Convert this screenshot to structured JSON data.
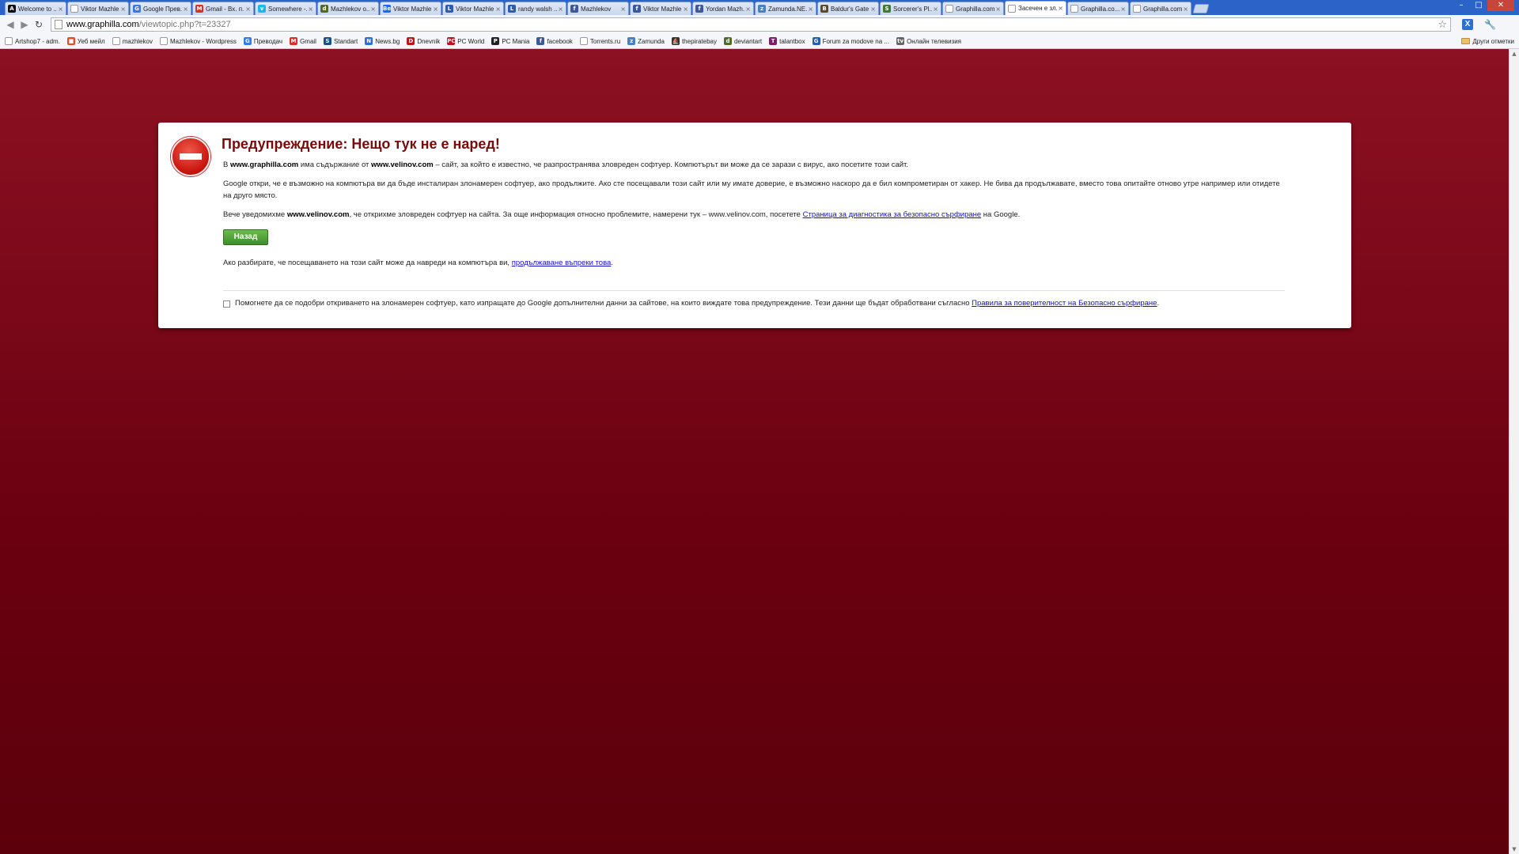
{
  "tabs": [
    {
      "label": "Welcome to ...",
      "icon": "A",
      "icon_bg": "#111111",
      "active": false
    },
    {
      "label": "Viktor Mazhle...",
      "icon": "",
      "icon_bg": "#ffffff",
      "active": false
    },
    {
      "label": "Google Прев...",
      "icon": "G",
      "icon_bg": "#3b78e7",
      "active": false
    },
    {
      "label": "Gmail - Вх. п...",
      "icon": "M",
      "icon_bg": "#d93025",
      "active": false
    },
    {
      "label": "Somewhere -...",
      "icon": "v",
      "icon_bg": "#1ab7ea",
      "active": false
    },
    {
      "label": "Mazhlekov o...",
      "icon": "d",
      "icon_bg": "#4f6b2a",
      "active": false
    },
    {
      "label": "Viktor Mazhle...",
      "icon": "Be",
      "icon_bg": "#1769ff",
      "active": false
    },
    {
      "label": "Viktor Mazhle...",
      "icon": "L",
      "icon_bg": "#2a5db0",
      "active": false
    },
    {
      "label": "randy walsh ...",
      "icon": "L",
      "icon_bg": "#2a5db0",
      "active": false
    },
    {
      "label": "Mazhlekov",
      "icon": "f",
      "icon_bg": "#3b5998",
      "active": false
    },
    {
      "label": "Viktor Mazhle...",
      "icon": "f",
      "icon_bg": "#3b5998",
      "active": false
    },
    {
      "label": "Yordan Mazh...",
      "icon": "f",
      "icon_bg": "#3b5998",
      "active": false
    },
    {
      "label": "Zamunda.NE...",
      "icon": "z",
      "icon_bg": "#4a7fc0",
      "active": false
    },
    {
      "label": "Baldur's Gate...",
      "icon": "B",
      "icon_bg": "#5b4a2a",
      "active": false
    },
    {
      "label": "Sorcerer's Pl...",
      "icon": "S",
      "icon_bg": "#3c7d2c",
      "active": false
    },
    {
      "label": "Graphilla.com...",
      "icon": "",
      "icon_bg": "#ffffff",
      "active": false
    },
    {
      "label": "Засечен е зл...",
      "icon": "",
      "icon_bg": "#ffffff",
      "active": true
    },
    {
      "label": "Graphilla.co...",
      "icon": "",
      "icon_bg": "#ffffff",
      "active": false
    },
    {
      "label": "Graphilla.com...",
      "icon": "",
      "icon_bg": "#ffffff",
      "active": false
    }
  ],
  "window_controls": {
    "minimize": "–",
    "maximize": "□",
    "close": "✕"
  },
  "toolbar": {
    "back_icon": "◀",
    "forward_icon": "▶",
    "reload_icon": "↻",
    "url_host": "www.graphilla.com",
    "url_path": "/viewtopic.php?t=23327",
    "star_icon": "☆",
    "extension_icon": "X",
    "wrench_icon": "🔧"
  },
  "bookmarks": [
    {
      "label": "Artshop7 - adm.",
      "icon": "",
      "icon_bg": "#ffffff"
    },
    {
      "label": "Уеб мейл",
      "icon": "■",
      "icon_bg": "#e34c26"
    },
    {
      "label": "mazhlekov",
      "icon": "",
      "icon_bg": "#ffffff"
    },
    {
      "label": "Mazhlekov - Wordpress",
      "icon": "",
      "icon_bg": "#ffffff"
    },
    {
      "label": "Преводач",
      "icon": "G",
      "icon_bg": "#3b78e7"
    },
    {
      "label": "Gmail",
      "icon": "M",
      "icon_bg": "#d93025"
    },
    {
      "label": "Standart",
      "icon": "S",
      "icon_bg": "#1a4f8a"
    },
    {
      "label": "News.bg",
      "icon": "N",
      "icon_bg": "#2a6fd6"
    },
    {
      "label": "Dnevnik",
      "icon": "D",
      "icon_bg": "#c0141c"
    },
    {
      "label": "PC World",
      "icon": "PC",
      "icon_bg": "#c0141c"
    },
    {
      "label": "PC Mania",
      "icon": "P",
      "icon_bg": "#222222"
    },
    {
      "label": "facebook",
      "icon": "f",
      "icon_bg": "#3b5998"
    },
    {
      "label": "Torrents.ru",
      "icon": "",
      "icon_bg": "#ffffff"
    },
    {
      "label": "Zamunda",
      "icon": "z",
      "icon_bg": "#4a7fc0"
    },
    {
      "label": "thepiratebay",
      "icon": "⛵",
      "icon_bg": "#333333"
    },
    {
      "label": "deviantart",
      "icon": "d",
      "icon_bg": "#4f6b2a"
    },
    {
      "label": "talantbox",
      "icon": "T",
      "icon_bg": "#7a1f6b"
    },
    {
      "label": "Forum za modove na ...",
      "icon": "G",
      "icon_bg": "#2a5db0"
    },
    {
      "label": "Онлайн телевизия",
      "icon": "tv",
      "icon_bg": "#666666"
    }
  ],
  "other_bookmarks": "Други отметки",
  "warning": {
    "title": "Предупреждение: Нещо тук не е наред!",
    "p1_prefix": "В ",
    "p1_site": "www.graphilla.com",
    "p1_mid": " има съдържание от ",
    "p1_malware_site": "www.velinov.com",
    "p1_suffix": " – сайт, за който е известно, че разпространява зловреден софтуер. Компютърът ви може да се зарази с вирус, ако посетите този сайт.",
    "p2": "Google откри, че е възможно на компютъра ви да бъде инсталиран злонамерен софтуер, ако продължите. Ако сте посещавали този сайт или му имате доверие, е възможно наскоро да е бил компрометиран от хакер. Не бива да продължавате, вместо това опитайте отново утре например или отидете на друго място.",
    "p3_prefix": "Вече уведомихме ",
    "p3_site": "www.velinov.com",
    "p3_mid": ", че открихме зловреден софтуер на сайта. За още информация относно проблемите, намерени тук – www.velinov.com, посетете ",
    "p3_link": "Страница за диагностика за безопасно сърфиране",
    "p3_suffix": " на Google.",
    "back_button": "Назад",
    "p4_prefix": "Ако разбирате, че посещаването на този сайт може да навреди на компютъра ви, ",
    "p4_link": "продължаване въпреки това",
    "p4_suffix": ".",
    "checkbox_prefix": "Помогнете да се подобри откриването на злонамерен софтуер, като изпращате до Google допълнителни данни за сайтове, на които виждате това предупреждение. Тези данни ще бъдат обработвани съгласно ",
    "checkbox_link": "Правила за поверителност на Безопасно сърфиране",
    "checkbox_suffix": "."
  },
  "scrollbar": {
    "up": "▲",
    "down": "▼"
  }
}
